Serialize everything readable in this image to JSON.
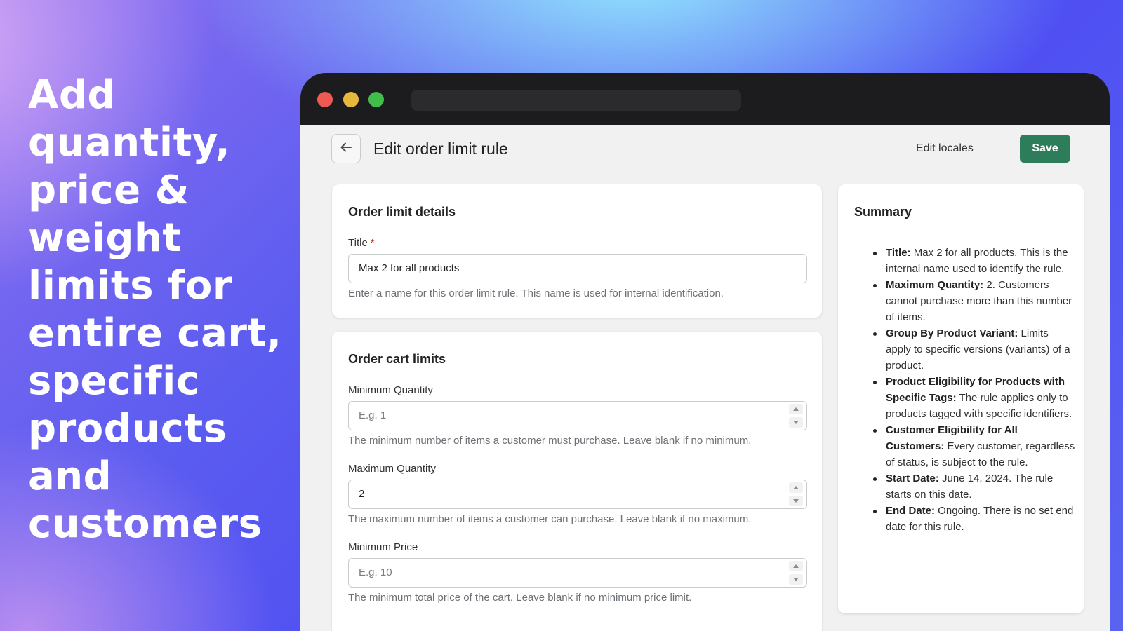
{
  "hero": {
    "headline": "Add quantity, price & weight limits for entire cart, specific products and customers"
  },
  "header": {
    "back_icon": "arrow-left-icon",
    "title": "Edit order limit rule",
    "edit_locales_label": "Edit locales",
    "save_label": "Save",
    "save_color": "#2e7d5a"
  },
  "details_card": {
    "title": "Order limit details",
    "title_field": {
      "label": "Title",
      "required_mark": "*",
      "value": "Max 2 for all products",
      "help": "Enter a name for this order limit rule. This name is used for internal identification."
    }
  },
  "cart_limits_card": {
    "title": "Order cart limits",
    "fields": [
      {
        "label": "Minimum Quantity",
        "placeholder": "E.g. 1",
        "value": "",
        "help": "The minimum number of items a customer must purchase. Leave blank if no minimum."
      },
      {
        "label": "Maximum Quantity",
        "placeholder": "",
        "value": "2",
        "help": "The maximum number of items a customer can purchase. Leave blank if no maximum."
      },
      {
        "label": "Minimum Price",
        "placeholder": "E.g. 10",
        "value": "",
        "help": "The minimum total price of the cart. Leave blank if no minimum price limit."
      }
    ]
  },
  "summary": {
    "title": "Summary",
    "items": [
      {
        "key": "Title:",
        "text": " Max 2 for all products. This is the internal name used to identify the rule."
      },
      {
        "key": "Maximum Quantity:",
        "text": " 2. Customers cannot purchase more than this number of items."
      },
      {
        "key": "Group By Product Variant:",
        "text": " Limits apply to specific versions (variants) of a product."
      },
      {
        "key": "Product Eligibility for Products with Specific Tags:",
        "text": " The rule applies only to products tagged with specific identifiers."
      },
      {
        "key": "Customer Eligibility for All Customers:",
        "text": " Every customer, regardless of status, is subject to the rule."
      },
      {
        "key": "Start Date:",
        "text": " June 14, 2024. The rule starts on this date."
      },
      {
        "key": "End Date:",
        "text": " Ongoing. There is no set end date for this rule."
      }
    ]
  }
}
